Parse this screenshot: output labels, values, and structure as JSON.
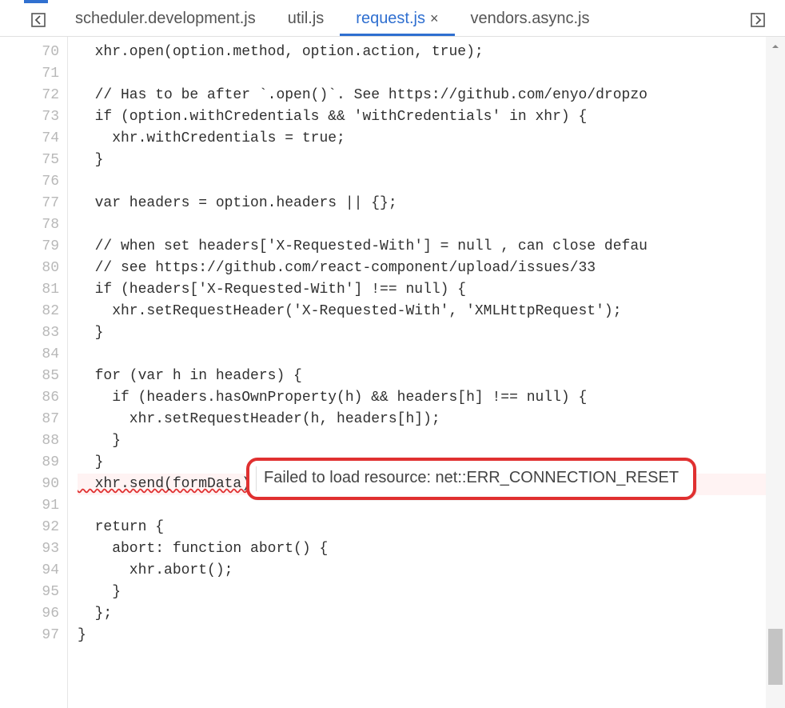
{
  "tabs": [
    {
      "label": "scheduler.development.js",
      "active": false
    },
    {
      "label": "util.js",
      "active": false
    },
    {
      "label": "request.js",
      "active": true
    },
    {
      "label": "vendors.async.js",
      "active": false
    }
  ],
  "gutter": {
    "start": 70,
    "end": 97
  },
  "code_lines": [
    "  xhr.open(option.method, option.action, true);",
    "",
    "  // Has to be after `.open()`. See https://github.com/enyo/dropzo",
    "  if (option.withCredentials && 'withCredentials' in xhr) {",
    "    xhr.withCredentials = true;",
    "  }",
    "",
    "  var headers = option.headers || {};",
    "",
    "  // when set headers['X-Requested-With'] = null , can close defau",
    "  // see https://github.com/react-component/upload/issues/33",
    "  if (headers['X-Requested-With'] !== null) {",
    "    xhr.setRequestHeader('X-Requested-With', 'XMLHttpRequest');",
    "  }",
    "",
    "  for (var h in headers) {",
    "    if (headers.hasOwnProperty(h) && headers[h] !== null) {",
    "      xhr.setRequestHeader(h, headers[h]);",
    "    }",
    "  }",
    "  xhr.send(formData);",
    "",
    "  return {",
    "    abort: function abort() {",
    "      xhr.abort();",
    "    }",
    "  };",
    "}"
  ],
  "error": {
    "line_index": 20,
    "squiggle_text": "  xhr.send(formData);",
    "badge": "×",
    "tooltip": "Failed to load resource: net::ERR_CONNECTION_RESET"
  },
  "icons": {
    "nav_left": "nav-left-icon",
    "nav_right": "nav-right-icon",
    "scroll_up": "scroll-up-icon",
    "close_tab": "×"
  }
}
